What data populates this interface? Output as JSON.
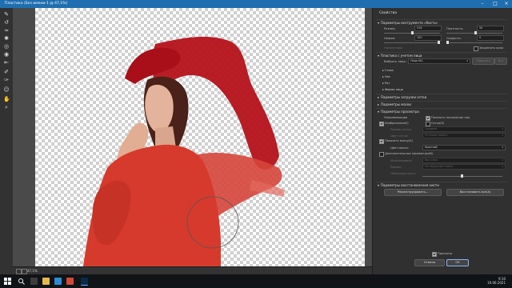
{
  "window": {
    "title": "Пластика (Без имени-1 @ 47,1%)"
  },
  "status": {
    "zoom": "47,1%"
  },
  "panel": {
    "title": "Свойства",
    "brush_section": "Параметры инструмента «Кисть»",
    "size_label": "Размер:",
    "size_value": "516",
    "density_label": "Плотность:",
    "density_value": "50",
    "pressure_label": "Нажим:",
    "pressure_value": "100",
    "rate_label": "Скорость:",
    "rate_value": "0",
    "pen_pressure": "Нажим пера",
    "pin_edges": "Закрепить края",
    "face_section": "Пластика с учетом лица",
    "select_face_label": "Выбрать лицо:",
    "select_face_value": "Лицо №1",
    "reset_label": "Сбросить",
    "all_label": "Все",
    "face_items": [
      "Глаза",
      "Нос",
      "Рот",
      "Форма лица"
    ],
    "mesh_section": "Параметры загрузки сетки",
    "mask_section": "Параметры маски",
    "view_section": "Параметры просмотра",
    "guides_label": "Направляющие",
    "show_face_overlay": "Показать наложение лиц",
    "image_label": "Изображение(I)",
    "mesh_label": "Сетка(E)",
    "mesh_size_label": "Размер сетки:",
    "mesh_size_value": "Средние",
    "mesh_color_label": "Цвет сетки:",
    "mesh_color_value": "Оттенки серого",
    "show_mask_label": "Показать маску(K)",
    "mask_color_label": "Цвет маски:",
    "mask_color_value": "Красный",
    "backdrop_label": "Дополнительные параметры(B)",
    "use_label": "Использовать:",
    "use_value": "Все слои",
    "mode_label": "Режим:",
    "mode_value": "На переднем плане",
    "opacity_label": "Непрозрачность:",
    "reconstruct_section": "Параметры восстановления кисти",
    "reconstruct_button": "Реконструировать...",
    "restore_all_button": "Восстановить все(A)",
    "preview_label": "Просмотр",
    "cancel_button": "Отмена",
    "ok_button": "OK"
  },
  "taskbar": {
    "time": "9:10",
    "date": "19.06.2021"
  },
  "colors": {
    "titlebar": "#1f6fb0",
    "mask_red": "#b5121b",
    "jacket": "#d63a2c"
  }
}
